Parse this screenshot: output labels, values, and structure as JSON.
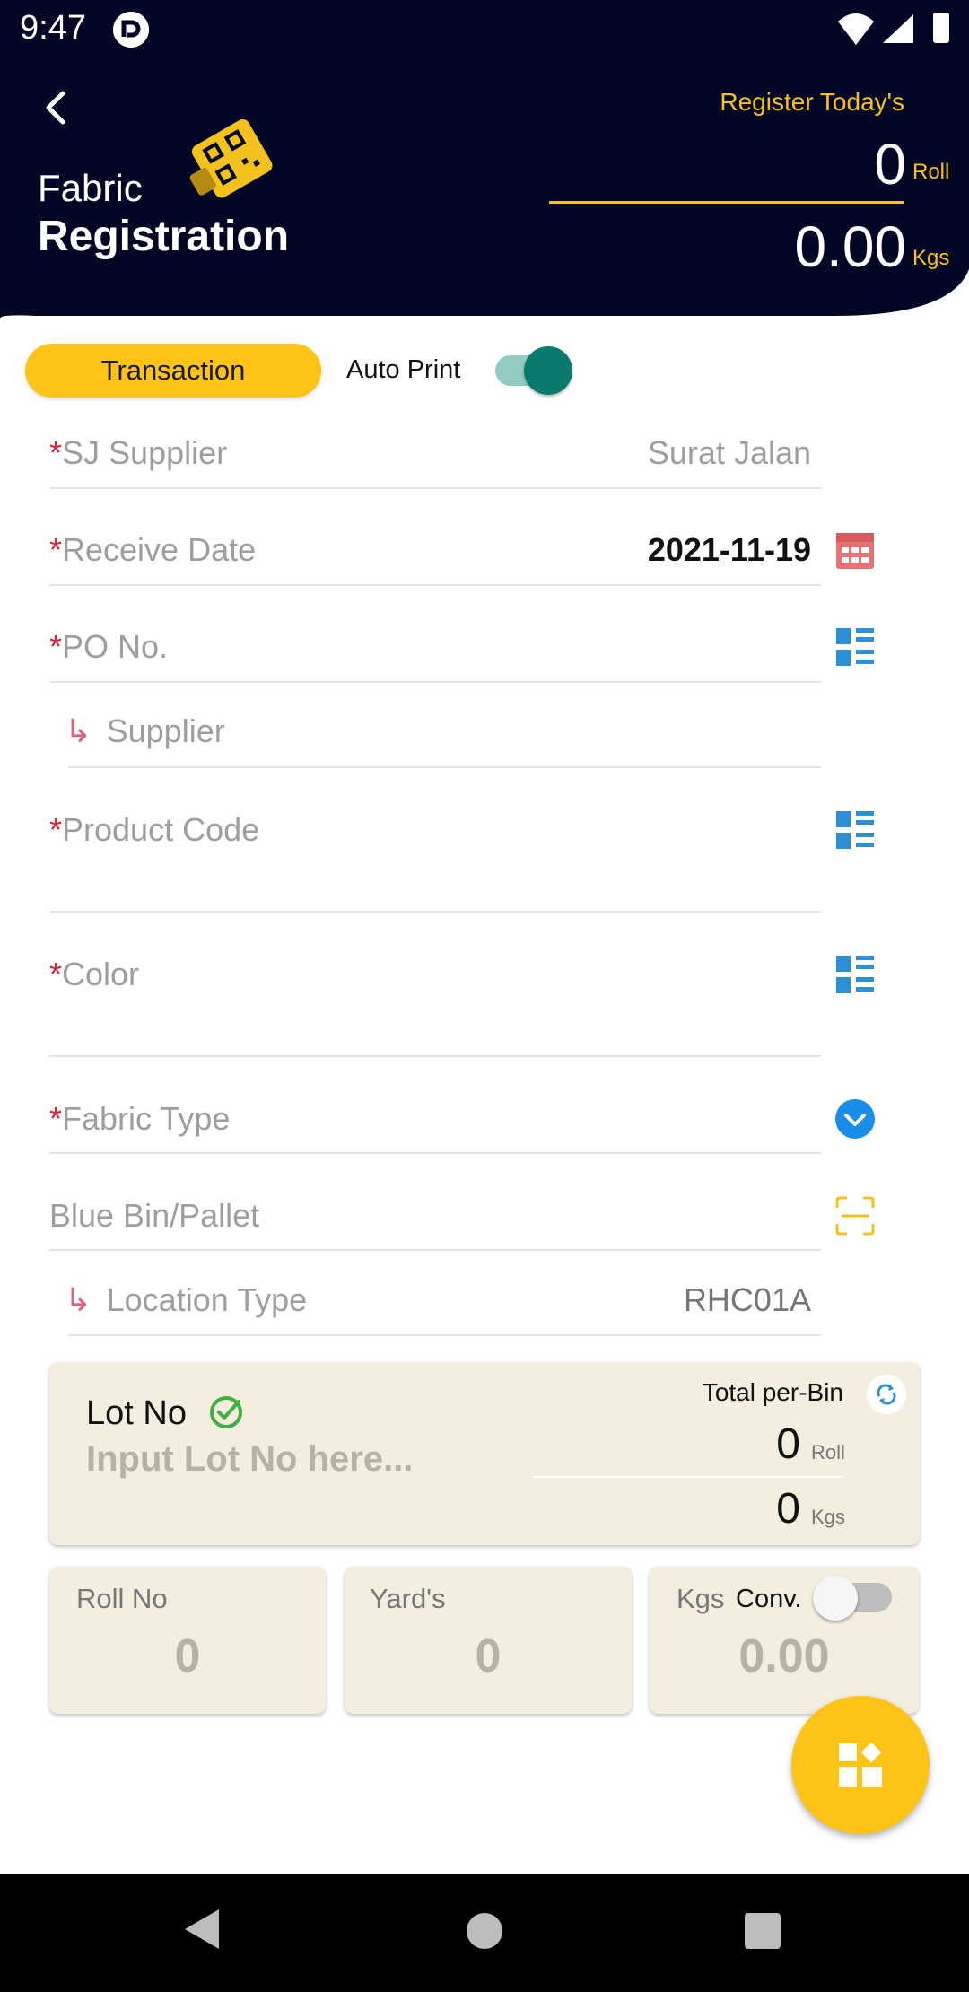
{
  "status_bar": {
    "time": "9:47"
  },
  "header": {
    "title_line1": "Fabric",
    "title_line2": "Registration",
    "today_label": "Register Today's",
    "roll_value": "0",
    "roll_unit": "Roll",
    "kgs_value": "0.00",
    "kgs_unit": "Kgs"
  },
  "toolbar": {
    "transaction_label": "Transaction",
    "auto_print_label": "Auto Print",
    "auto_print_on": true
  },
  "form": {
    "required_mark": "*",
    "sub_arrow": "↳",
    "sj_supplier": {
      "label": "SJ Supplier",
      "placeholder": "Surat Jalan"
    },
    "receive_date": {
      "label": "Receive Date",
      "value": "2021-11-19"
    },
    "po_no": {
      "label": "PO No."
    },
    "supplier": {
      "label": "Supplier"
    },
    "product_code": {
      "label": "Product Code"
    },
    "color": {
      "label": "Color"
    },
    "fabric_type": {
      "label": "Fabric Type"
    },
    "blue_bin": {
      "label": "Blue Bin/Pallet"
    },
    "location_type": {
      "label": "Location Type",
      "value": "RHC01A"
    }
  },
  "lot": {
    "label": "Lot No",
    "placeholder": "Input Lot No here...",
    "total_label": "Total per-Bin",
    "roll_value": "0",
    "roll_unit": "Roll",
    "kgs_value": "0",
    "kgs_unit": "Kgs"
  },
  "stats": {
    "roll_no": {
      "label": "Roll No",
      "value": "0"
    },
    "yards": {
      "label": "Yard's",
      "value": "0"
    },
    "kgs": {
      "label": "Kgs",
      "conv_label": "Conv.",
      "value": "0.00",
      "conv_on": false
    }
  },
  "colors": {
    "header_bg": "#040626",
    "accent": "#fdc317",
    "required": "#d9243a",
    "icon_blue": "#2e8fd6",
    "calendar_red": "#e57373",
    "toggle_teal": "#0a7a6d",
    "card_bg": "#f3eedd"
  },
  "icons": {
    "back": "back-arrow-icon",
    "calendar": "calendar-icon",
    "list": "list-icon",
    "dropdown": "chevron-down-circle-icon",
    "scan": "scan-icon",
    "check": "check-circle-icon",
    "refresh": "refresh-icon",
    "fab": "grid-add-icon"
  }
}
